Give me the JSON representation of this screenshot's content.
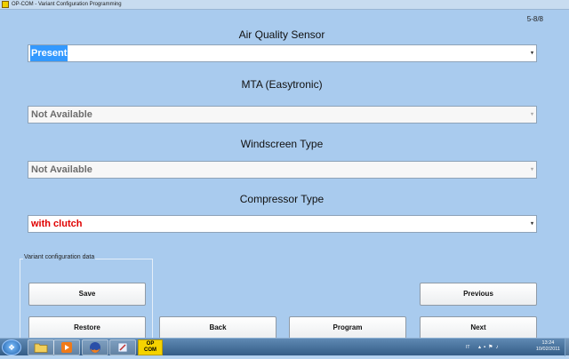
{
  "window": {
    "title": "OP-COM - Variant Configuration Programming"
  },
  "page_indicator": "5-8/8",
  "fields": [
    {
      "label": "Air Quality Sensor",
      "value": "Present",
      "state": "selected"
    },
    {
      "label": "MTA (Easytronic)",
      "value": "Not Available",
      "state": "disabled"
    },
    {
      "label": "Windscreen Type",
      "value": "Not Available",
      "state": "disabled"
    },
    {
      "label": "Compressor Type",
      "value": "with clutch",
      "state": "normal",
      "value_color": "#e00000"
    }
  ],
  "group": {
    "legend": "Variant configuration data"
  },
  "buttons": {
    "save": "Save",
    "restore": "Restore",
    "back": "Back",
    "program": "Program",
    "previous": "Previous",
    "next": "Next"
  },
  "taskbar": {
    "start_icon": "windows-orb-icon",
    "items": [
      "folder-icon",
      "media-player-icon",
      "firefox-icon",
      "paint-icon"
    ],
    "opcom_label_line1": "OP",
    "opcom_label_line2": "COM",
    "tray": {
      "language": "IT",
      "time": "13:24",
      "date": "10/02/2011"
    }
  }
}
